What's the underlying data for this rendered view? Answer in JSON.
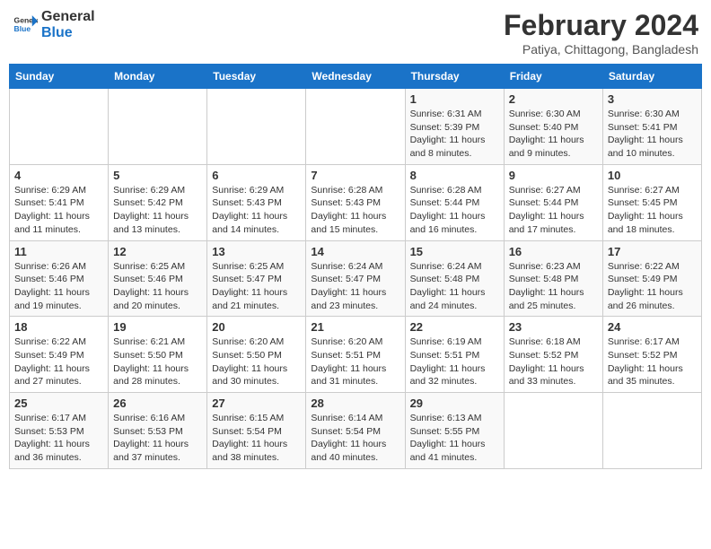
{
  "header": {
    "logo_line1": "General",
    "logo_line2": "Blue",
    "title": "February 2024",
    "subtitle": "Patiya, Chittagong, Bangladesh"
  },
  "weekdays": [
    "Sunday",
    "Monday",
    "Tuesday",
    "Wednesday",
    "Thursday",
    "Friday",
    "Saturday"
  ],
  "weeks": [
    [
      {
        "day": "",
        "sunrise": "",
        "sunset": "",
        "daylight": ""
      },
      {
        "day": "",
        "sunrise": "",
        "sunset": "",
        "daylight": ""
      },
      {
        "day": "",
        "sunrise": "",
        "sunset": "",
        "daylight": ""
      },
      {
        "day": "",
        "sunrise": "",
        "sunset": "",
        "daylight": ""
      },
      {
        "day": "1",
        "sunrise": "6:31 AM",
        "sunset": "5:39 PM",
        "daylight": "11 hours and 8 minutes."
      },
      {
        "day": "2",
        "sunrise": "6:30 AM",
        "sunset": "5:40 PM",
        "daylight": "11 hours and 9 minutes."
      },
      {
        "day": "3",
        "sunrise": "6:30 AM",
        "sunset": "5:41 PM",
        "daylight": "11 hours and 10 minutes."
      }
    ],
    [
      {
        "day": "4",
        "sunrise": "6:29 AM",
        "sunset": "5:41 PM",
        "daylight": "11 hours and 11 minutes."
      },
      {
        "day": "5",
        "sunrise": "6:29 AM",
        "sunset": "5:42 PM",
        "daylight": "11 hours and 13 minutes."
      },
      {
        "day": "6",
        "sunrise": "6:29 AM",
        "sunset": "5:43 PM",
        "daylight": "11 hours and 14 minutes."
      },
      {
        "day": "7",
        "sunrise": "6:28 AM",
        "sunset": "5:43 PM",
        "daylight": "11 hours and 15 minutes."
      },
      {
        "day": "8",
        "sunrise": "6:28 AM",
        "sunset": "5:44 PM",
        "daylight": "11 hours and 16 minutes."
      },
      {
        "day": "9",
        "sunrise": "6:27 AM",
        "sunset": "5:44 PM",
        "daylight": "11 hours and 17 minutes."
      },
      {
        "day": "10",
        "sunrise": "6:27 AM",
        "sunset": "5:45 PM",
        "daylight": "11 hours and 18 minutes."
      }
    ],
    [
      {
        "day": "11",
        "sunrise": "6:26 AM",
        "sunset": "5:46 PM",
        "daylight": "11 hours and 19 minutes."
      },
      {
        "day": "12",
        "sunrise": "6:25 AM",
        "sunset": "5:46 PM",
        "daylight": "11 hours and 20 minutes."
      },
      {
        "day": "13",
        "sunrise": "6:25 AM",
        "sunset": "5:47 PM",
        "daylight": "11 hours and 21 minutes."
      },
      {
        "day": "14",
        "sunrise": "6:24 AM",
        "sunset": "5:47 PM",
        "daylight": "11 hours and 23 minutes."
      },
      {
        "day": "15",
        "sunrise": "6:24 AM",
        "sunset": "5:48 PM",
        "daylight": "11 hours and 24 minutes."
      },
      {
        "day": "16",
        "sunrise": "6:23 AM",
        "sunset": "5:48 PM",
        "daylight": "11 hours and 25 minutes."
      },
      {
        "day": "17",
        "sunrise": "6:22 AM",
        "sunset": "5:49 PM",
        "daylight": "11 hours and 26 minutes."
      }
    ],
    [
      {
        "day": "18",
        "sunrise": "6:22 AM",
        "sunset": "5:49 PM",
        "daylight": "11 hours and 27 minutes."
      },
      {
        "day": "19",
        "sunrise": "6:21 AM",
        "sunset": "5:50 PM",
        "daylight": "11 hours and 28 minutes."
      },
      {
        "day": "20",
        "sunrise": "6:20 AM",
        "sunset": "5:50 PM",
        "daylight": "11 hours and 30 minutes."
      },
      {
        "day": "21",
        "sunrise": "6:20 AM",
        "sunset": "5:51 PM",
        "daylight": "11 hours and 31 minutes."
      },
      {
        "day": "22",
        "sunrise": "6:19 AM",
        "sunset": "5:51 PM",
        "daylight": "11 hours and 32 minutes."
      },
      {
        "day": "23",
        "sunrise": "6:18 AM",
        "sunset": "5:52 PM",
        "daylight": "11 hours and 33 minutes."
      },
      {
        "day": "24",
        "sunrise": "6:17 AM",
        "sunset": "5:52 PM",
        "daylight": "11 hours and 35 minutes."
      }
    ],
    [
      {
        "day": "25",
        "sunrise": "6:17 AM",
        "sunset": "5:53 PM",
        "daylight": "11 hours and 36 minutes."
      },
      {
        "day": "26",
        "sunrise": "6:16 AM",
        "sunset": "5:53 PM",
        "daylight": "11 hours and 37 minutes."
      },
      {
        "day": "27",
        "sunrise": "6:15 AM",
        "sunset": "5:54 PM",
        "daylight": "11 hours and 38 minutes."
      },
      {
        "day": "28",
        "sunrise": "6:14 AM",
        "sunset": "5:54 PM",
        "daylight": "11 hours and 40 minutes."
      },
      {
        "day": "29",
        "sunrise": "6:13 AM",
        "sunset": "5:55 PM",
        "daylight": "11 hours and 41 minutes."
      },
      {
        "day": "",
        "sunrise": "",
        "sunset": "",
        "daylight": ""
      },
      {
        "day": "",
        "sunrise": "",
        "sunset": "",
        "daylight": ""
      }
    ]
  ]
}
